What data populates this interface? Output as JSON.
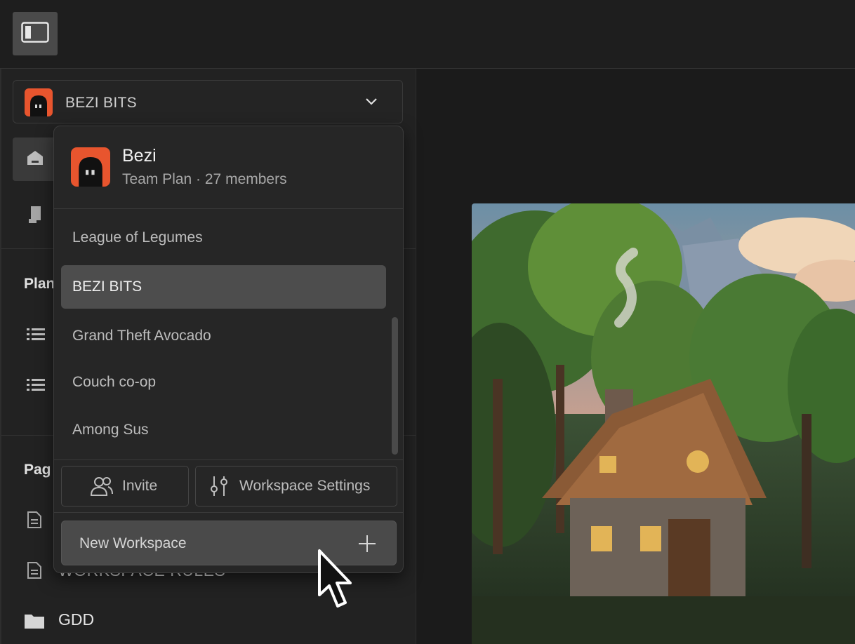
{
  "workspace_selector": {
    "name": "BEZI BITS"
  },
  "sidebar": {
    "headings": {
      "planning": "Plan",
      "pages": "Pag"
    },
    "items": {
      "workspace_rules": "WORKSPACE RULES",
      "gdd": "GDD"
    }
  },
  "dropdown": {
    "org_name": "Bezi",
    "org_meta": "Team Plan · 27 members",
    "workspaces": [
      {
        "label": "League of Legumes",
        "active": false
      },
      {
        "label": "BEZI BITS",
        "active": true
      },
      {
        "label": "Grand Theft Avocado",
        "active": false
      },
      {
        "label": "Couch co-op",
        "active": false
      },
      {
        "label": "Among Sus",
        "active": false
      }
    ],
    "invite_label": "Invite",
    "settings_label": "Workspace Settings",
    "new_workspace_label": "New Workspace"
  },
  "colors": {
    "brand": "#e8552e",
    "active_item": "#4d4d4d",
    "panel": "#262626"
  }
}
